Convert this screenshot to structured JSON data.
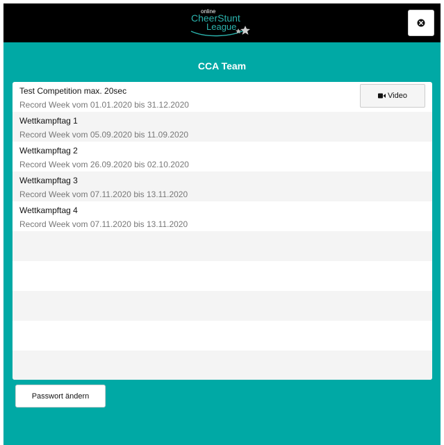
{
  "header": {
    "logo_text": {
      "small": "online",
      "line1": "CheerStunt",
      "line2": "League"
    },
    "close_icon": "circle-x-icon"
  },
  "team": {
    "title": "CCA Team"
  },
  "competitions": [
    {
      "title": "Test Competition max. 20sec",
      "subtitle": "Record Week vom 01.01.2020 bis 31.12.2020",
      "has_video": true
    },
    {
      "title": "Wettkampftag 1",
      "subtitle": "Record Week vom 05.09.2020 bis 11.09.2020",
      "has_video": false
    },
    {
      "title": "Wettkampftag 2",
      "subtitle": "Record Week vom 26.09.2020 bis 02.10.2020",
      "has_video": false
    },
    {
      "title": "Wettkampftag 3",
      "subtitle": "Record Week vom 07.11.2020 bis 13.11.2020",
      "has_video": false
    },
    {
      "title": "Wettkampftag 4",
      "subtitle": "Record Week vom 07.11.2020 bis 13.11.2020",
      "has_video": false
    }
  ],
  "video_button": {
    "label": "Video",
    "icon": "video-camera-icon"
  },
  "password_button": {
    "label": "Passwort ändern"
  },
  "colors": {
    "background": "#00a9a5",
    "topbar": "#000000",
    "accent": "#1fa7a1"
  }
}
